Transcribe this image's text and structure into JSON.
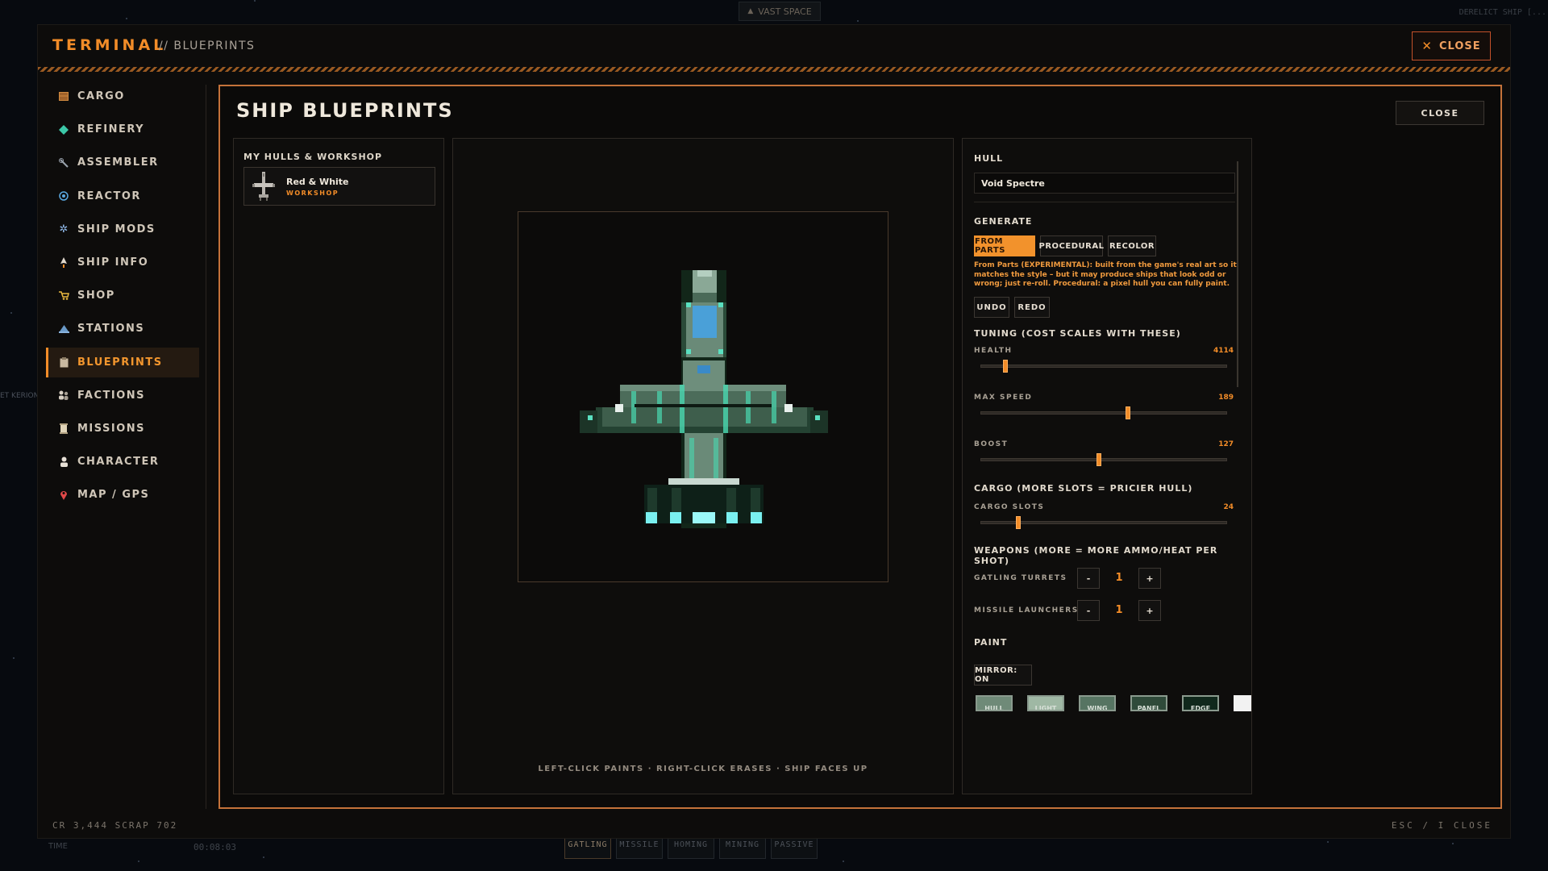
{
  "background": {
    "top_label": "VAST SPACE",
    "corner_label": "DERELICT SHIP [...",
    "left_label": "ET KERION",
    "timer": "00:08:03",
    "time_label": "TIME",
    "bottom_tabs": [
      "GATLING",
      "MISSILE",
      "HOMING",
      "MINING",
      "PASSIVE"
    ]
  },
  "terminal": {
    "title": "TERMINAL",
    "subtitle": "// BLUEPRINTS",
    "close_label": "CLOSE",
    "footer_left": "CR 3,444   SCRAP 702",
    "footer_right": "ESC / I  CLOSE"
  },
  "sidebar": {
    "items": [
      {
        "label": "CARGO",
        "icon": "crate-icon"
      },
      {
        "label": "REFINERY",
        "icon": "gem-icon"
      },
      {
        "label": "ASSEMBLER",
        "icon": "wrench-icon"
      },
      {
        "label": "REACTOR",
        "icon": "reactor-icon"
      },
      {
        "label": "SHIP MODS",
        "icon": "gear-icon"
      },
      {
        "label": "SHIP INFO",
        "icon": "rocket-icon"
      },
      {
        "label": "SHOP",
        "icon": "cart-icon"
      },
      {
        "label": "STATIONS",
        "icon": "station-icon"
      },
      {
        "label": "BLUEPRINTS",
        "icon": "clipboard-icon"
      },
      {
        "label": "FACTIONS",
        "icon": "people-icon"
      },
      {
        "label": "MISSIONS",
        "icon": "scroll-icon"
      },
      {
        "label": "CHARACTER",
        "icon": "person-icon"
      },
      {
        "label": "MAP / GPS",
        "icon": "pin-icon"
      }
    ],
    "active": "BLUEPRINTS"
  },
  "blueprints": {
    "title": "SHIP BLUEPRINTS",
    "close_label": "CLOSE",
    "hulls_title": "MY HULLS & WORKSHOP",
    "hull_card": {
      "name": "Red & White",
      "tag": "WORKSHOP"
    },
    "canvas_hint": "LEFT-CLICK PAINTS · RIGHT-CLICK ERASES · SHIP FACES UP"
  },
  "editor": {
    "hull_heading": "HULL",
    "hull_name": "Void Spectre",
    "generate_heading": "GENERATE",
    "generate_buttons": [
      "FROM PARTS",
      "PROCEDURAL",
      "RECOLOR"
    ],
    "generate_active": "FROM PARTS",
    "generate_note": "From Parts (EXPERIMENTAL): built from the game's real art so it matches the style – but it may produce ships that look odd or wrong; just re-roll. Procedural: a pixel hull you can fully paint.",
    "undo_label": "UNDO",
    "redo_label": "REDO",
    "tuning_heading": "TUNING (COST SCALES WITH THESE)",
    "sliders": [
      {
        "label": "HEALTH",
        "value": "4114",
        "fraction": 0.1
      },
      {
        "label": "MAX SPEED",
        "value": "189",
        "fraction": 0.6
      },
      {
        "label": "BOOST",
        "value": "127",
        "fraction": 0.48
      }
    ],
    "cargo_heading": "CARGO (MORE SLOTS = PRICIER HULL)",
    "cargo_slider": {
      "label": "CARGO SLOTS",
      "value": "24",
      "fraction": 0.15
    },
    "weapons_heading": "WEAPONS (MORE = MORE AMMO/HEAT PER SHOT)",
    "steppers": [
      {
        "label": "GATLING TURRETS",
        "value": "1",
        "minus": "-",
        "plus": "+"
      },
      {
        "label": "MISSILE LAUNCHERS",
        "value": "1",
        "minus": "-",
        "plus": "+"
      }
    ],
    "paint_heading": "PAINT",
    "mirror_label": "MIRROR: ON",
    "swatches": [
      {
        "label": "HULL",
        "color": "#6f8a78"
      },
      {
        "label": "LIGHT",
        "color": "#9fb8a4"
      },
      {
        "label": "WING",
        "color": "#567462"
      },
      {
        "label": "PANEL",
        "color": "#2f4a3a"
      },
      {
        "label": "EDGE",
        "color": "#10281c"
      },
      {
        "label": "",
        "color": "#f2f2f2"
      }
    ],
    "colors": {
      "accent": "#f28c28",
      "panel_border": "#c4723a"
    }
  }
}
